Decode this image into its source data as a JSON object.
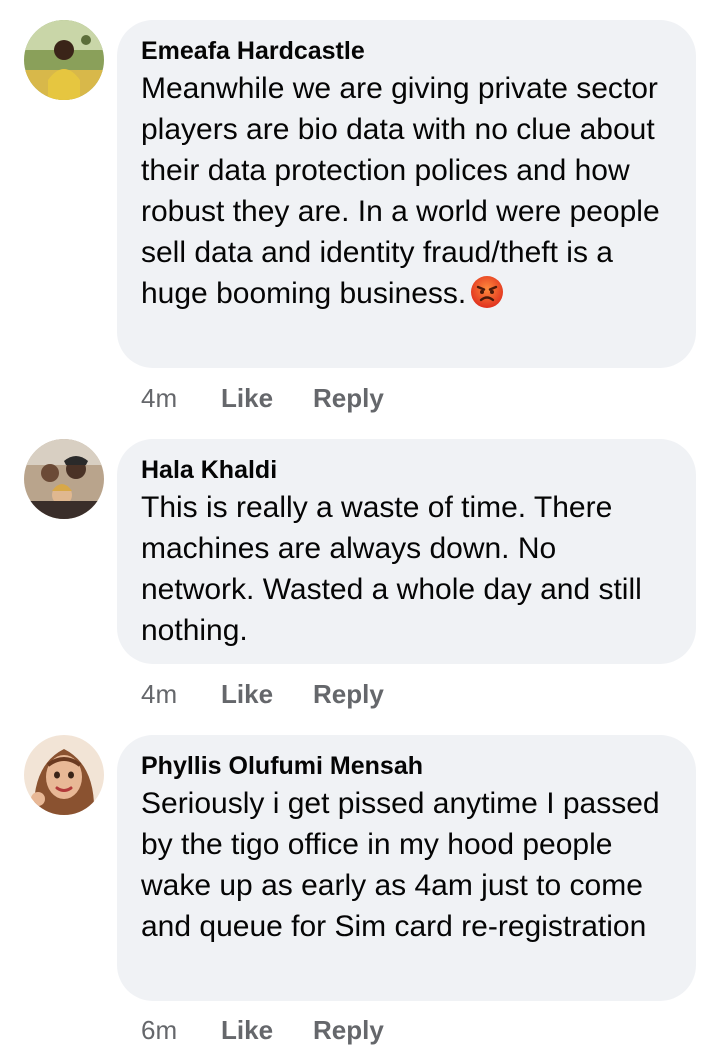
{
  "comments": [
    {
      "author": "Emeafa Hardcastle",
      "text": "Meanwhile we are giving private sector players are bio data with no clue about their data protection polices and how robust they are. In a world were people sell data and identity fraud/theft is a huge booming business.",
      "emoji": "angry-face",
      "time": "4m",
      "like_label": "Like",
      "reply_label": "Reply"
    },
    {
      "author": "Hala Khaldi",
      "text": "This is really a waste of time. There machines are always down. No network. Wasted a whole day and still nothing.",
      "time": "4m",
      "like_label": "Like",
      "reply_label": "Reply"
    },
    {
      "author": "Phyllis Olufumi Mensah",
      "text": "Seriously i get pissed anytime I passed by the tigo office in my hood people wake up as early as 4am just to come and queue for Sim card re-registration",
      "time": "6m",
      "like_label": "Like",
      "reply_label": "Reply"
    }
  ],
  "colors": {
    "bubble": "#f0f2f5",
    "meta": "#65676b",
    "text": "#050505"
  }
}
